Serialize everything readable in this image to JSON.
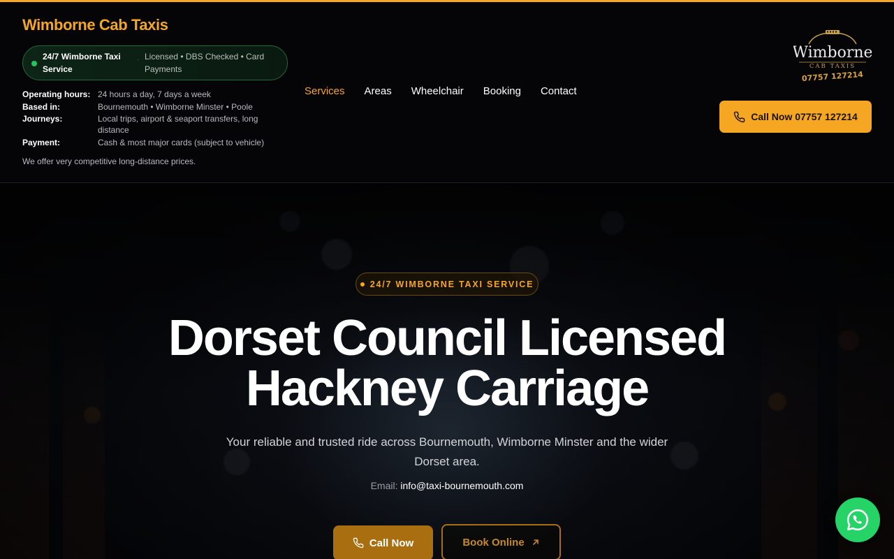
{
  "brand": {
    "name": "Wimborne Cab Taxis"
  },
  "status_pill": {
    "title": "24/7 Wimborne Taxi Service",
    "separator": "·",
    "subtitle": "Licensed • DBS Checked • Card Payments"
  },
  "info": [
    {
      "key": "Operating hours:",
      "value": "24 hours a day, 7 days a week"
    },
    {
      "key": "Based in:",
      "value": "Bournemouth • Wimborne Minster • Poole"
    },
    {
      "key": "Journeys:",
      "value": "Local trips, airport & seaport transfers, long distance"
    },
    {
      "key": "Payment:",
      "value": "Cash & most major cards (subject to vehicle)"
    }
  ],
  "info_note": "We offer very competitive long-distance prices.",
  "nav": {
    "items": [
      {
        "label": "Services",
        "active": true
      },
      {
        "label": "Areas",
        "active": false
      },
      {
        "label": "Wheelchair",
        "active": false
      },
      {
        "label": "Booking",
        "active": false
      },
      {
        "label": "Contact",
        "active": false
      }
    ]
  },
  "logo": {
    "line1": "Wimborne",
    "line2": "CAB TAXIS",
    "phone": "07757 127214"
  },
  "header_call": {
    "label": "Call Now 07757 127214",
    "icon": "phone-icon"
  },
  "hero": {
    "badge": "24/7 WIMBORNE TAXI SERVICE",
    "title_line1": "Dorset Council Licensed",
    "title_line2": "Hackney Carriage",
    "subtitle": "Your reliable and trusted ride across Bournemouth, Wimborne Minster and the wider Dorset area.",
    "email_label": "Email:",
    "email": "info@taxi-bournemouth.com",
    "call_button": "Call Now",
    "book_button": "Book Online"
  },
  "whatsapp": {
    "icon": "whatsapp-icon"
  },
  "colors": {
    "accent": "#f5a623",
    "status_green": "#22c55e",
    "whatsapp": "#25d366",
    "background": "#07070a"
  }
}
